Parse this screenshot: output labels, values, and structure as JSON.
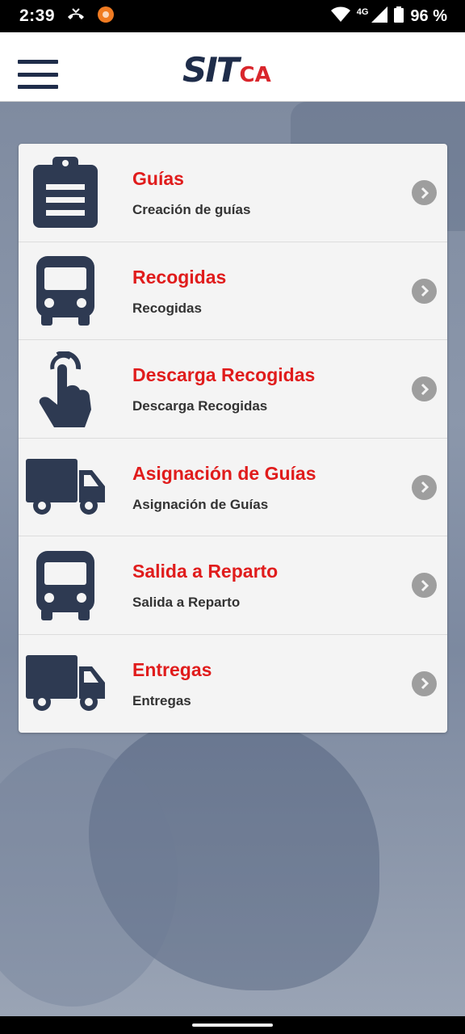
{
  "status_bar": {
    "time": "2:39",
    "network_label": "4G",
    "battery_text": "96 %"
  },
  "header": {
    "logo_main": "SIT",
    "logo_suffix": "CA",
    "brand_color": "#1f2d4a",
    "accent_color": "#d9262c"
  },
  "menu": {
    "items": [
      {
        "title": "Guías",
        "subtitle": "Creación de guías",
        "icon": "clipboard-icon"
      },
      {
        "title": "Recogidas",
        "subtitle": "Recogidas",
        "icon": "bus-icon"
      },
      {
        "title": "Descarga Recogidas",
        "subtitle": "Descarga Recogidas",
        "icon": "hand-pointer-icon"
      },
      {
        "title": "Asignación de Guías",
        "subtitle": "Asignación de Guías",
        "icon": "truck-icon"
      },
      {
        "title": "Salida a Reparto",
        "subtitle": "Salida a Reparto",
        "icon": "bus-icon"
      },
      {
        "title": "Entregas",
        "subtitle": "Entregas",
        "icon": "truck-icon"
      }
    ]
  }
}
